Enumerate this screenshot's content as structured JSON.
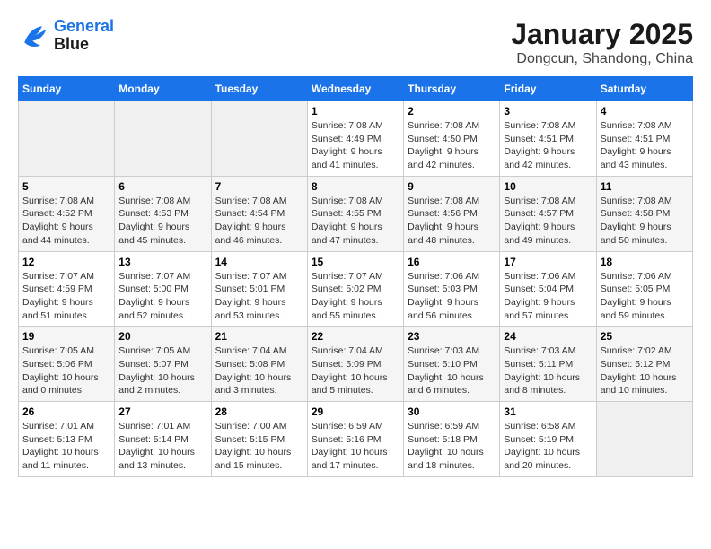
{
  "header": {
    "logo_line1": "General",
    "logo_line2": "Blue",
    "month": "January 2025",
    "location": "Dongcun, Shandong, China"
  },
  "weekdays": [
    "Sunday",
    "Monday",
    "Tuesday",
    "Wednesday",
    "Thursday",
    "Friday",
    "Saturday"
  ],
  "weeks": [
    [
      {
        "day": "",
        "info": ""
      },
      {
        "day": "",
        "info": ""
      },
      {
        "day": "",
        "info": ""
      },
      {
        "day": "1",
        "info": "Sunrise: 7:08 AM\nSunset: 4:49 PM\nDaylight: 9 hours and 41 minutes."
      },
      {
        "day": "2",
        "info": "Sunrise: 7:08 AM\nSunset: 4:50 PM\nDaylight: 9 hours and 42 minutes."
      },
      {
        "day": "3",
        "info": "Sunrise: 7:08 AM\nSunset: 4:51 PM\nDaylight: 9 hours and 42 minutes."
      },
      {
        "day": "4",
        "info": "Sunrise: 7:08 AM\nSunset: 4:51 PM\nDaylight: 9 hours and 43 minutes."
      }
    ],
    [
      {
        "day": "5",
        "info": "Sunrise: 7:08 AM\nSunset: 4:52 PM\nDaylight: 9 hours and 44 minutes."
      },
      {
        "day": "6",
        "info": "Sunrise: 7:08 AM\nSunset: 4:53 PM\nDaylight: 9 hours and 45 minutes."
      },
      {
        "day": "7",
        "info": "Sunrise: 7:08 AM\nSunset: 4:54 PM\nDaylight: 9 hours and 46 minutes."
      },
      {
        "day": "8",
        "info": "Sunrise: 7:08 AM\nSunset: 4:55 PM\nDaylight: 9 hours and 47 minutes."
      },
      {
        "day": "9",
        "info": "Sunrise: 7:08 AM\nSunset: 4:56 PM\nDaylight: 9 hours and 48 minutes."
      },
      {
        "day": "10",
        "info": "Sunrise: 7:08 AM\nSunset: 4:57 PM\nDaylight: 9 hours and 49 minutes."
      },
      {
        "day": "11",
        "info": "Sunrise: 7:08 AM\nSunset: 4:58 PM\nDaylight: 9 hours and 50 minutes."
      }
    ],
    [
      {
        "day": "12",
        "info": "Sunrise: 7:07 AM\nSunset: 4:59 PM\nDaylight: 9 hours and 51 minutes."
      },
      {
        "day": "13",
        "info": "Sunrise: 7:07 AM\nSunset: 5:00 PM\nDaylight: 9 hours and 52 minutes."
      },
      {
        "day": "14",
        "info": "Sunrise: 7:07 AM\nSunset: 5:01 PM\nDaylight: 9 hours and 53 minutes."
      },
      {
        "day": "15",
        "info": "Sunrise: 7:07 AM\nSunset: 5:02 PM\nDaylight: 9 hours and 55 minutes."
      },
      {
        "day": "16",
        "info": "Sunrise: 7:06 AM\nSunset: 5:03 PM\nDaylight: 9 hours and 56 minutes."
      },
      {
        "day": "17",
        "info": "Sunrise: 7:06 AM\nSunset: 5:04 PM\nDaylight: 9 hours and 57 minutes."
      },
      {
        "day": "18",
        "info": "Sunrise: 7:06 AM\nSunset: 5:05 PM\nDaylight: 9 hours and 59 minutes."
      }
    ],
    [
      {
        "day": "19",
        "info": "Sunrise: 7:05 AM\nSunset: 5:06 PM\nDaylight: 10 hours and 0 minutes."
      },
      {
        "day": "20",
        "info": "Sunrise: 7:05 AM\nSunset: 5:07 PM\nDaylight: 10 hours and 2 minutes."
      },
      {
        "day": "21",
        "info": "Sunrise: 7:04 AM\nSunset: 5:08 PM\nDaylight: 10 hours and 3 minutes."
      },
      {
        "day": "22",
        "info": "Sunrise: 7:04 AM\nSunset: 5:09 PM\nDaylight: 10 hours and 5 minutes."
      },
      {
        "day": "23",
        "info": "Sunrise: 7:03 AM\nSunset: 5:10 PM\nDaylight: 10 hours and 6 minutes."
      },
      {
        "day": "24",
        "info": "Sunrise: 7:03 AM\nSunset: 5:11 PM\nDaylight: 10 hours and 8 minutes."
      },
      {
        "day": "25",
        "info": "Sunrise: 7:02 AM\nSunset: 5:12 PM\nDaylight: 10 hours and 10 minutes."
      }
    ],
    [
      {
        "day": "26",
        "info": "Sunrise: 7:01 AM\nSunset: 5:13 PM\nDaylight: 10 hours and 11 minutes."
      },
      {
        "day": "27",
        "info": "Sunrise: 7:01 AM\nSunset: 5:14 PM\nDaylight: 10 hours and 13 minutes."
      },
      {
        "day": "28",
        "info": "Sunrise: 7:00 AM\nSunset: 5:15 PM\nDaylight: 10 hours and 15 minutes."
      },
      {
        "day": "29",
        "info": "Sunrise: 6:59 AM\nSunset: 5:16 PM\nDaylight: 10 hours and 17 minutes."
      },
      {
        "day": "30",
        "info": "Sunrise: 6:59 AM\nSunset: 5:18 PM\nDaylight: 10 hours and 18 minutes."
      },
      {
        "day": "31",
        "info": "Sunrise: 6:58 AM\nSunset: 5:19 PM\nDaylight: 10 hours and 20 minutes."
      },
      {
        "day": "",
        "info": ""
      }
    ]
  ]
}
